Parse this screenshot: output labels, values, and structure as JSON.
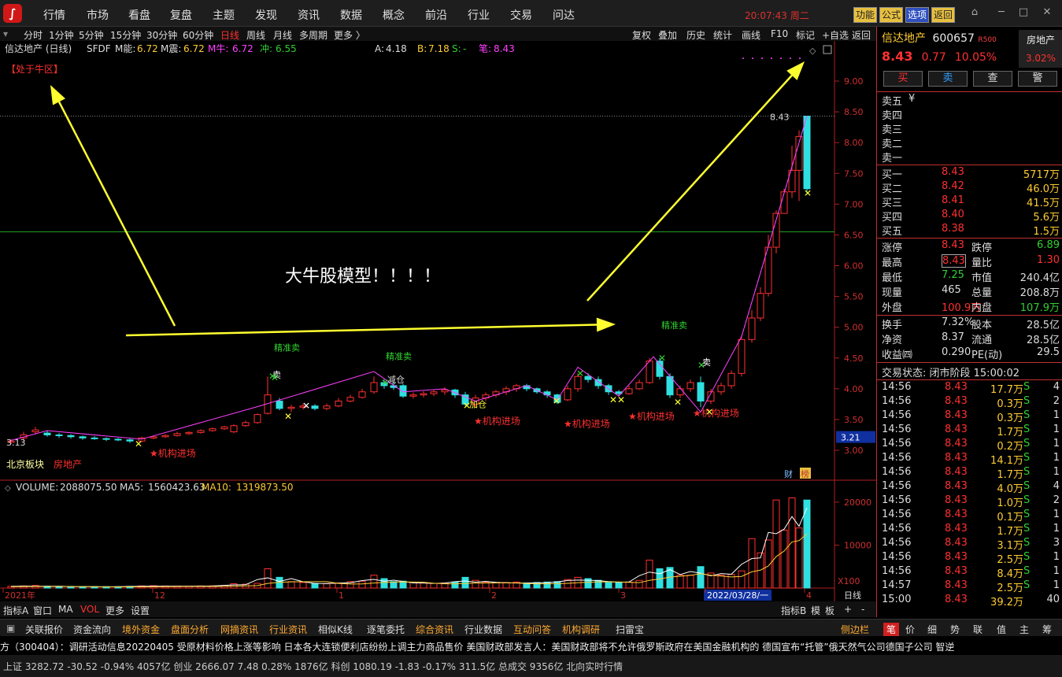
{
  "menu": [
    "行情",
    "市场",
    "看盘",
    "复盘",
    "主题",
    "发现",
    "资讯",
    "数据",
    "概念",
    "前沿",
    "行业",
    "交易",
    "问达"
  ],
  "clock": "20:07:43 周二",
  "top_buttons": [
    "功能",
    "公式",
    "选项",
    "返回"
  ],
  "periods": [
    "分时",
    "1分钟",
    "5分钟",
    "15分钟",
    "30分钟",
    "60分钟",
    "日线",
    "周线",
    "月线",
    "多周期",
    "更多 〉"
  ],
  "tools": [
    "复权",
    "叠加",
    "历史",
    "统计",
    "画线",
    "F10",
    "标记",
    "+自选",
    "返回"
  ],
  "chart": {
    "indicator_line": {
      "name": "信达地产 (日线)",
      "ind": "SFDF",
      "m_label": "M能:",
      "m_val": "6.72",
      "mz_label": "M震:",
      "mz_val": "6.72",
      "mn_label": "M牛:",
      "mn_val": "6.72",
      "c_label": "冲:",
      "c_val": "6.55",
      "a_label": "A:",
      "a_val": "4.18",
      "b_label": "B:",
      "b_val": "7.18",
      "s_label": "S:",
      "s_val": "-",
      "bi_label": "笔:",
      "bi_val": "8.43"
    },
    "zone_label": "【处于牛区】",
    "annotation": "大牛股模型！！！！",
    "price_ticks": [
      "9.00",
      "8.50",
      "8.00",
      "7.50",
      "7.00",
      "6.50",
      "6.00",
      "5.50",
      "5.00",
      "4.50",
      "4.00",
      "3.50",
      "3.00"
    ],
    "current_price_box": "3.21",
    "high_label": "8.43",
    "low_label": "3.13",
    "signals_buy": [
      "精准卖",
      "精准卖",
      "精准卖"
    ],
    "jigou": "★机构进场",
    "jiancang": "减仓",
    "jiacang": "加仓",
    "mai": "卖",
    "sector_label": "北京板块",
    "sector_label2": "房地产",
    "fin_badge": "财",
    "bang_badge": "榜",
    "volume_line": {
      "label": "VOLUME:",
      "val": "2088075.50",
      "ma5_label": "MA5:",
      "ma5": "1560423.63",
      "ma10_label": "MA10:",
      "ma10": "1319873.50"
    },
    "vol_ticks": [
      "20000",
      "10000",
      "X100"
    ],
    "x_labels": [
      "2021年",
      "12",
      "1",
      "2",
      "3",
      "2022/03/28/一",
      "4"
    ],
    "period_label": "日线"
  },
  "bottom_tabs": [
    "指标A",
    "窗口",
    "MA",
    "VOL",
    "更多",
    "设置"
  ],
  "bottom_right": [
    "指标B",
    "模",
    "板",
    "+",
    "-"
  ],
  "func_tabs": [
    "关联报价",
    "资金流向",
    "境外资金",
    "盘面分析",
    "网摘资讯",
    "行业资讯",
    "相似K线",
    "逐笔委托",
    "综合资讯",
    "行业数据",
    "互动问答",
    "机构调研",
    "扫雷宝"
  ],
  "func_side": "侧边栏",
  "rp_tabs": [
    "笔",
    "价",
    "细",
    "势",
    "联",
    "值",
    "主",
    "筹"
  ],
  "ticker": "方（300404）：调研活动信息20220405     受原材料价格上涨等影响 日本各大连锁便利店纷纷上调主力商品售价          美国财政部发言人：美国财政部将不允许俄罗斯政府在美国金融机构的          德国宣布“托管”俄天然气公司德国子公司        智逆",
  "status_text": "上证 3282.72  -30.52  -0.94%   4057亿   创业 2666.07   7.48  0.28%   1876亿   科创 1080.19   -1.83  -0.17%   311.5亿   总成交   9356亿     北向实时行情",
  "stock": {
    "name": "信达地产",
    "code": "600657",
    "tag": "R500",
    "sector": "房地产",
    "sector_pct": "3.02%",
    "price": "8.43",
    "chg": "0.77",
    "pct": "10.05%"
  },
  "trade_buttons": [
    "买",
    "卖",
    "查",
    "警"
  ],
  "ask": [
    {
      "l": "卖五",
      "p": "¥",
      "v": ""
    },
    {
      "l": "卖四",
      "p": "",
      "v": ""
    },
    {
      "l": "卖三",
      "p": "",
      "v": ""
    },
    {
      "l": "卖二",
      "p": "",
      "v": ""
    },
    {
      "l": "卖一",
      "p": "",
      "v": ""
    }
  ],
  "bid": [
    {
      "l": "买一",
      "p": "8.43",
      "v": "5717万"
    },
    {
      "l": "买二",
      "p": "8.42",
      "v": "46.0万"
    },
    {
      "l": "买三",
      "p": "8.41",
      "v": "41.5万"
    },
    {
      "l": "买四",
      "p": "8.40",
      "v": "5.6万"
    },
    {
      "l": "买五",
      "p": "8.38",
      "v": "1.5万"
    }
  ],
  "stats": [
    {
      "a": "涨停",
      "av": "8.43",
      "b": "跌停",
      "bv": "6.89"
    },
    {
      "a": "最高",
      "av": "8.43",
      "b": "量比",
      "bv": "1.30"
    },
    {
      "a": "最低",
      "av": "7.25",
      "b": "市值",
      "bv": "240.4亿"
    },
    {
      "a": "现量",
      "av": "465",
      "b": "总量",
      "bv": "208.8万"
    },
    {
      "a": "外盘",
      "av": "100.9万",
      "b": "内盘",
      "bv": "107.9万"
    }
  ],
  "stats2": [
    {
      "a": "换手",
      "av": "7.32%",
      "b": "股本",
      "bv": "28.5亿"
    },
    {
      "a": "净资",
      "av": "8.37",
      "b": "流通",
      "bv": "28.5亿"
    },
    {
      "a": "收益㈣",
      "av": "0.290",
      "b": "PE(动)",
      "bv": "29.5"
    }
  ],
  "trade_status": "交易状态: 闭市阶段 15:00:02",
  "ticks": [
    {
      "t": "14:56",
      "p": "8.43",
      "v": "17.7万",
      "s": "S",
      "n": "4"
    },
    {
      "t": "14:56",
      "p": "8.43",
      "v": "0.3万",
      "s": "S",
      "n": "2"
    },
    {
      "t": "14:56",
      "p": "8.43",
      "v": "0.3万",
      "s": "S",
      "n": "1"
    },
    {
      "t": "14:56",
      "p": "8.43",
      "v": "1.7万",
      "s": "S",
      "n": "1"
    },
    {
      "t": "14:56",
      "p": "8.43",
      "v": "0.2万",
      "s": "S",
      "n": "1"
    },
    {
      "t": "14:56",
      "p": "8.43",
      "v": "14.1万",
      "s": "S",
      "n": "1"
    },
    {
      "t": "14:56",
      "p": "8.43",
      "v": "1.7万",
      "s": "S",
      "n": "1"
    },
    {
      "t": "14:56",
      "p": "8.43",
      "v": "4.0万",
      "s": "S",
      "n": "4"
    },
    {
      "t": "14:56",
      "p": "8.43",
      "v": "1.0万",
      "s": "S",
      "n": "2"
    },
    {
      "t": "14:56",
      "p": "8.43",
      "v": "0.1万",
      "s": "S",
      "n": "1"
    },
    {
      "t": "14:56",
      "p": "8.43",
      "v": "1.7万",
      "s": "S",
      "n": "1"
    },
    {
      "t": "14:56",
      "p": "8.43",
      "v": "3.1万",
      "s": "S",
      "n": "3"
    },
    {
      "t": "14:56",
      "p": "8.43",
      "v": "2.5万",
      "s": "S",
      "n": "1"
    },
    {
      "t": "14:56",
      "p": "8.43",
      "v": "8.4万",
      "s": "S",
      "n": "1"
    },
    {
      "t": "14:57",
      "p": "8.43",
      "v": "2.5万",
      "s": "S",
      "n": "1"
    },
    {
      "t": "15:00",
      "p": "8.43",
      "v": "39.2万",
      "s": "",
      "n": "40"
    }
  ],
  "colors": {
    "up": "#ff3030",
    "down": "#30e0e0",
    "green": "#30d030",
    "yellow": "#ffff30",
    "magenta": "#ff40ff"
  }
}
